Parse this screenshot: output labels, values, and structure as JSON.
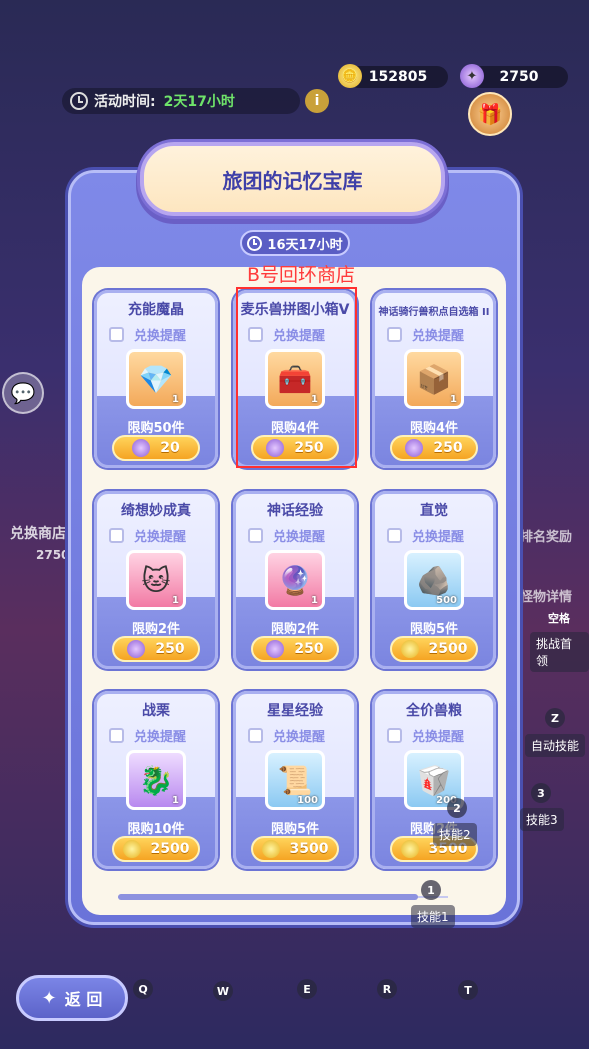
{
  "currency": {
    "gold": "152805",
    "gems": "2750"
  },
  "event": {
    "label": "活动时间:",
    "time": "2天17小时"
  },
  "shop": {
    "title": "旅团的记忆宝库",
    "countdown": "16天17小时",
    "annotation": "B号回环商店",
    "remind_label": "兑换提醒"
  },
  "items": [
    {
      "name": "充能魔晶",
      "qty": "1",
      "limit": "限购50件",
      "price": "20",
      "currency": "gem",
      "slot": "orange",
      "glyph": "💎"
    },
    {
      "name": "麦乐兽拼图小箱V",
      "qty": "1",
      "limit": "限购4件",
      "price": "250",
      "currency": "gem",
      "slot": "orange",
      "glyph": "🧰"
    },
    {
      "name": "神话骑行兽积点自选箱 II",
      "qty": "1",
      "limit": "限购4件",
      "price": "250",
      "currency": "gem",
      "slot": "orange",
      "glyph": "📦"
    },
    {
      "name": "绮想妙成真",
      "qty": "1",
      "limit": "限购2件",
      "price": "250",
      "currency": "gem",
      "slot": "pink",
      "glyph": "🐱"
    },
    {
      "name": "神话经验",
      "qty": "1",
      "limit": "限购2件",
      "price": "250",
      "currency": "gem",
      "slot": "pink",
      "glyph": "🔮"
    },
    {
      "name": "直觉",
      "qty": "500",
      "limit": "限购5件",
      "price": "2500",
      "currency": "gold",
      "slot": "blue",
      "glyph": "🪨"
    },
    {
      "name": "战栗",
      "qty": "1",
      "limit": "限购10件",
      "price": "2500",
      "currency": "gold",
      "slot": "purple",
      "glyph": "🐉"
    },
    {
      "name": "星星经验",
      "qty": "100",
      "limit": "限购5件",
      "price": "3500",
      "currency": "gold",
      "slot": "blue",
      "glyph": "📜"
    },
    {
      "name": "全价兽粮",
      "qty": "200",
      "limit": "限购2件",
      "price": "3500",
      "currency": "gold",
      "slot": "blue",
      "glyph": "🥡"
    }
  ],
  "side_labels": {
    "exchange_shop": "兑换商店",
    "exchange_count": "2750",
    "rank_reward": "排名奖励",
    "monster_detail": "怪物详情"
  },
  "key_hints": {
    "space": "空格",
    "space_action": "挑战首领",
    "z": "Z",
    "z_action": "自动技能",
    "k3": "3",
    "k3_action": "技能3",
    "k2": "2",
    "k2_action": "技能2",
    "k1": "1",
    "k1_action": "技能1",
    "q": "Q",
    "w": "W",
    "e": "E",
    "r": "R",
    "t": "T"
  },
  "back_label": "返 回"
}
